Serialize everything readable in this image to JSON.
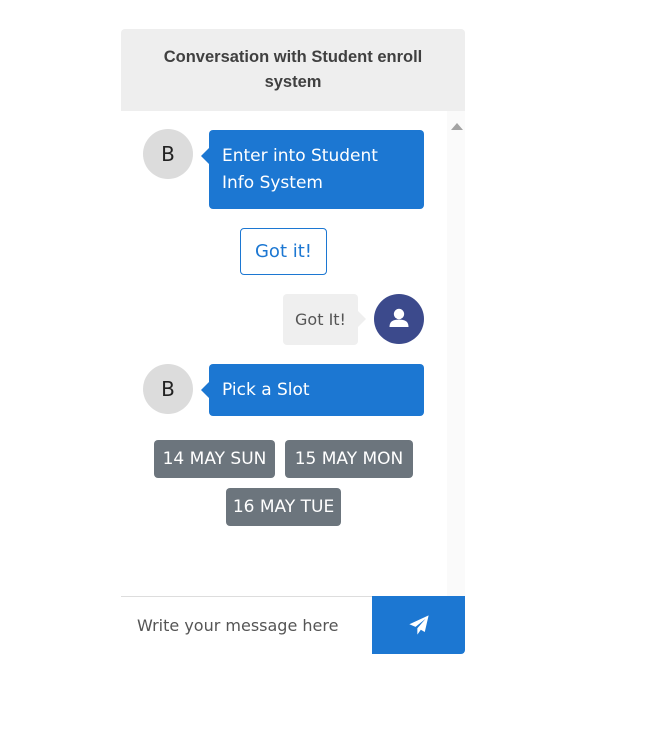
{
  "header": {
    "title": "Conversation with Student enroll system"
  },
  "messages": {
    "bot_avatar_letter": "B",
    "bot_message_1": "Enter into Student Info System",
    "quick_reply": "Got it!",
    "user_message_1": "Got It!",
    "bot_message_2": "Pick a Slot",
    "slots": [
      "14 MAY SUN",
      "15 MAY MON",
      "16 MAY TUE"
    ]
  },
  "footer": {
    "input_placeholder": "Write your message here",
    "input_value": "",
    "send_icon": "paper-plane-icon"
  },
  "icons": {
    "user_avatar": "user-icon",
    "scroll_up": "triangle-up-icon"
  },
  "colors": {
    "accent": "#1c77d2",
    "header_bg": "#eeeeee",
    "user_bubble": "#efefef",
    "user_avatar": "#3c4a8c",
    "slot_button": "#6c757d",
    "bot_avatar": "#dcdcdc"
  }
}
